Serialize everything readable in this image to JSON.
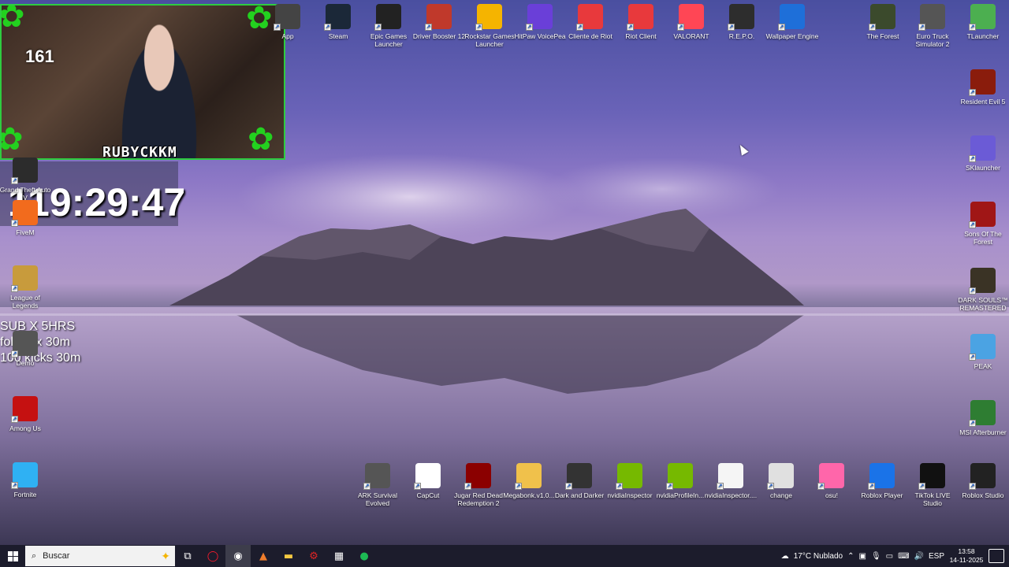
{
  "webcam": {
    "viewer_count": "161",
    "overlay_name": "RUBYCKKM"
  },
  "timer": {
    "value": "119:29:47"
  },
  "sub_rules": [
    "SUB X 5HRS",
    "follow x 30m",
    "100 kicks 30m"
  ],
  "desktop_icons_top": [
    {
      "label": "App",
      "icon": "app-icon",
      "color": "#444"
    },
    {
      "label": "Steam",
      "icon": "steam-icon",
      "color": "#1b2838"
    },
    {
      "label": "Epic Games Launcher",
      "icon": "epic-icon",
      "color": "#222"
    },
    {
      "label": "Driver Booster 12",
      "icon": "driver-booster-icon",
      "color": "#c0392b"
    },
    {
      "label": "Rockstar Games Launcher",
      "icon": "rockstar-icon",
      "color": "#f5b400"
    },
    {
      "label": "HitPaw VoicePea",
      "icon": "hitpaw-icon",
      "color": "#6a3fd8"
    },
    {
      "label": "Cliente de Riot",
      "icon": "riot-icon",
      "color": "#e8393c"
    },
    {
      "label": "Riot Client",
      "icon": "riot-icon",
      "color": "#e8393c"
    },
    {
      "label": "VALORANT",
      "icon": "valorant-icon",
      "color": "#ff4655"
    },
    {
      "label": "R.E.P.O.",
      "icon": "repo-icon",
      "color": "#2d2d2d"
    },
    {
      "label": "Wallpaper Engine",
      "icon": "wallpaper-engine-icon",
      "color": "#1e6fd9"
    },
    {
      "label": "The Forest",
      "icon": "forest-icon",
      "color": "#3b4a2c"
    },
    {
      "label": "Euro Truck Simulator 2",
      "icon": "truck-icon",
      "color": "#555"
    },
    {
      "label": "TLauncher",
      "icon": "tlauncher-icon",
      "color": "#4caf50"
    }
  ],
  "desktop_icons_right": [
    {
      "label": "Resident Evil 5",
      "icon": "re5-icon",
      "color": "#8a1c0c"
    },
    {
      "label": "SKlauncher",
      "icon": "sklauncher-icon",
      "color": "#6b5bd6"
    },
    {
      "label": "Sons Of The Forest",
      "icon": "sotf-icon",
      "color": "#a01616"
    },
    {
      "label": "DARK SOULS™ REMASTERED",
      "icon": "darksouls-icon",
      "color": "#3a3325"
    },
    {
      "label": "PEAK",
      "icon": "peak-icon",
      "color": "#4ba3e3"
    },
    {
      "label": "MSI Afterburner",
      "icon": "msi-icon",
      "color": "#2e7d32"
    }
  ],
  "desktop_icons_left": [
    {
      "label": "Grand Theft Auto V",
      "icon": "gta-icon",
      "color": "#2c2c2c"
    },
    {
      "label": "FiveM",
      "icon": "fivem-icon",
      "color": "#f26b1d"
    },
    {
      "label": "League of Legends",
      "icon": "lol-icon",
      "color": "#c89b3c"
    },
    {
      "label": "Demo",
      "icon": "demo-icon",
      "color": "#555"
    },
    {
      "label": "Among Us",
      "icon": "among-us-icon",
      "color": "#c51111"
    },
    {
      "label": "Fortnite",
      "icon": "fortnite-icon",
      "color": "#2fb1f3"
    }
  ],
  "desktop_icons_bottom": [
    {
      "label": "ARK Survival Evolved",
      "icon": "ark-icon",
      "color": "#555"
    },
    {
      "label": "CapCut",
      "icon": "capcut-icon",
      "color": "#fff"
    },
    {
      "label": "Jugar Red Dead Redemption 2",
      "icon": "rdr2-icon",
      "color": "#8b0000"
    },
    {
      "label": "Megabonk.v1.0...",
      "icon": "folder-icon",
      "color": "#f0c14b"
    },
    {
      "label": "Dark and Darker",
      "icon": "dark-darker-icon",
      "color": "#333"
    },
    {
      "label": "nvidiaInspector",
      "icon": "nvidia-icon",
      "color": "#76b900"
    },
    {
      "label": "nvidiaProfileIn...",
      "icon": "nvidia-icon",
      "color": "#76b900"
    },
    {
      "label": "nvidiaInspector....",
      "icon": "file-icon",
      "color": "#f5f5f5"
    },
    {
      "label": "change",
      "icon": "file-icon",
      "color": "#e0e0e0"
    },
    {
      "label": "osu!",
      "icon": "osu-icon",
      "color": "#ff66aa"
    },
    {
      "label": "Roblox Player",
      "icon": "roblox-icon",
      "color": "#1a73e8"
    },
    {
      "label": "TikTok LIVE Studio",
      "icon": "tiktok-icon",
      "color": "#111"
    },
    {
      "label": "Roblox Studio",
      "icon": "roblox-studio-icon",
      "color": "#222"
    }
  ],
  "taskbar": {
    "search_placeholder": "Buscar",
    "apps": [
      "task-view-icon",
      "opera-icon",
      "obs-icon",
      "app-icon",
      "file-explorer-icon",
      "driver-booster-icon",
      "store-icon",
      "spotify-icon"
    ],
    "weather": "17°C  Nublado",
    "language": "ESP",
    "time": "13:58",
    "date": "14-11-2025"
  }
}
